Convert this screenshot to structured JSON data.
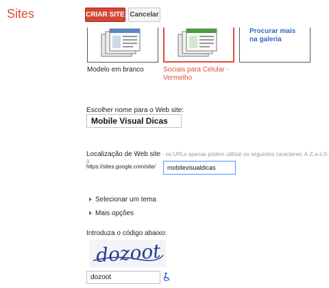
{
  "app": {
    "title": "Sites"
  },
  "toolbar": {
    "create_label": "CRIAR SITE",
    "cancel_label": "Cancelar"
  },
  "templates": {
    "items": [
      {
        "label": "Modelo em branco"
      },
      {
        "label": "Sociais para Celular - Vermelho",
        "selected": true
      }
    ],
    "gallery_link": "Procurar mais na galeria"
  },
  "form": {
    "name_label": "Escolher nome para o Web site:",
    "name_value": "Mobile Visual Dicas",
    "location_label": "Localização de Web site",
    "location_hint": "- os URLs apenas podem utilizar os seguintes caracteres: A-Z,a-z,0-9",
    "url_prefix": "https://sites.google.com/site/",
    "url_value": "mobilevisualdicas",
    "theme_toggle": "Selecionar um tema",
    "more_options": "Mais opções",
    "captcha_label": "Introduza o código abaixo:",
    "captcha_text": "dozoot",
    "captcha_value": "dozoot"
  },
  "icons": {
    "template_thumb": "stacked-pages-icon",
    "accessibility": "wheelchair-icon"
  },
  "colors": {
    "brand_red": "#dd4b39",
    "create_button": "#d14836",
    "link_blue": "#3366cc",
    "focus_blue": "#4d90fe",
    "captcha_ink": "#2a3d8f"
  }
}
